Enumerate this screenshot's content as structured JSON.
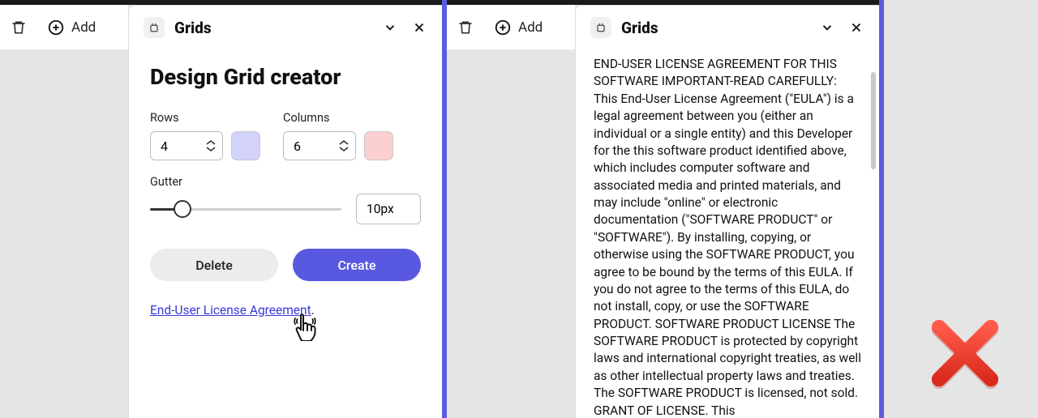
{
  "toolbar": {
    "add_label": "Add"
  },
  "panel": {
    "title": "Grids"
  },
  "form": {
    "heading": "Design Grid creator",
    "rows_label": "Rows",
    "rows_value": "4",
    "columns_label": "Columns",
    "columns_value": "6",
    "gutter_label": "Gutter",
    "gutter_value": "10px",
    "delete_label": "Delete",
    "create_label": "Create",
    "eula_link_text": "End-User License Agreement",
    "eula_link_suffix": "."
  },
  "colors": {
    "rows_swatch": "#d2d2fb",
    "columns_swatch": "#fcd0d0",
    "accent": "#5858e0"
  },
  "eula": {
    "body": "END-USER LICENSE AGREEMENT FOR THIS SOFTWARE IMPORTANT-READ CAREFULLY: This End-User License Agreement (\"EULA\") is a legal agreement between you (either an individual or a single entity) and this Developer for the this software product identified above, which includes computer software and associated media and printed materials, and may include \"online\" or electronic documentation (\"SOFTWARE PRODUCT\" or \"SOFTWARE\"). By installing, copying, or otherwise using the SOFTWARE PRODUCT, you agree to be bound by the terms of this EULA. If you do not agree to the terms of this EULA, do not install, copy, or use the SOFTWARE PRODUCT. SOFTWARE PRODUCT LICENSE The SOFTWARE PRODUCT is protected by copyright laws and international copyright treaties, as well as other intellectual property laws and treaties. The SOFTWARE PRODUCT is licensed, not sold. GRANT OF LICENSE. This"
  }
}
